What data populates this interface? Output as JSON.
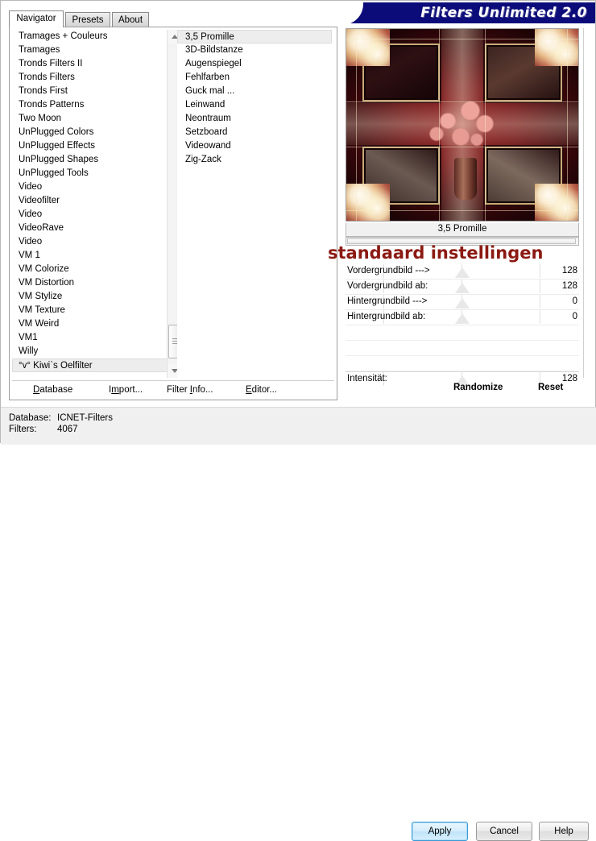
{
  "window": {
    "title": "Filters Unlimited 2.0"
  },
  "tabs": [
    {
      "label": "Navigator",
      "active": true
    },
    {
      "label": "Presets",
      "active": false
    },
    {
      "label": "About",
      "active": false
    }
  ],
  "categories": {
    "items": [
      "Tramages + Couleurs",
      "Tramages",
      "Tronds Filters II",
      "Tronds Filters",
      "Tronds First",
      "Tronds Patterns",
      "Two Moon",
      "UnPlugged Colors",
      "UnPlugged Effects",
      "UnPlugged Shapes",
      "UnPlugged Tools",
      "Video",
      "Videofilter",
      "Video",
      "VideoRave",
      "Video",
      "VM 1",
      "VM Colorize",
      "VM Distortion",
      "VM Stylize",
      "VM Texture",
      "VM Weird",
      "VM1",
      "Willy",
      "°v° Kiwi`s Oelfilter"
    ],
    "selected_index": 24
  },
  "filters": {
    "items": [
      "3,5 Promille",
      "3D-Bildstanze",
      "Augenspiegel",
      "Fehlfarben",
      "Guck mal ...",
      "Leinwand",
      "Neontraum",
      "Setzboard",
      "Videowand",
      "Zig-Zack"
    ],
    "selected_index": 0
  },
  "left_menu": [
    {
      "label": "Database",
      "accel": "D",
      "pre": "",
      "post": "atabase"
    },
    {
      "label": "Import...",
      "accel": "m",
      "pre": "I",
      "post": "port..."
    },
    {
      "label": "Filter Info...",
      "accel": "I",
      "pre": "Filter ",
      "post": "nfo..."
    },
    {
      "label": "Editor...",
      "accel": "E",
      "pre": "",
      "post": "ditor..."
    }
  ],
  "preview": {
    "caption": "3,5 Promille",
    "overlay_text": "standaard instellingen",
    "overlay_color": "#8b1a12"
  },
  "parameters": [
    {
      "label": "Vordergrundbild --->",
      "value": "128",
      "thumb_pct": 50
    },
    {
      "label": "Vordergrundbild ab:",
      "value": "128",
      "thumb_pct": 50
    },
    {
      "label": "Hintergrundbild --->",
      "value": "0",
      "thumb_pct": 50
    },
    {
      "label": "Hintergrundbild ab:",
      "value": "0",
      "thumb_pct": 50
    }
  ],
  "intensity": {
    "label": "Intensität:",
    "value": "128",
    "thumb_pct": 50
  },
  "right_menu": {
    "randomize": "Randomize",
    "reset": "Reset"
  },
  "status": {
    "database_key": "Database:",
    "database_value": "ICNET-Filters",
    "filters_key": "Filters:",
    "filters_value": "4067"
  },
  "dialog_buttons": {
    "apply": "Apply",
    "cancel": "Cancel",
    "help": "Help"
  },
  "colors": {
    "titlebar": "#0b0b7a",
    "accent_red": "#8b1a12",
    "focus_blue": "#3c9ad6"
  }
}
